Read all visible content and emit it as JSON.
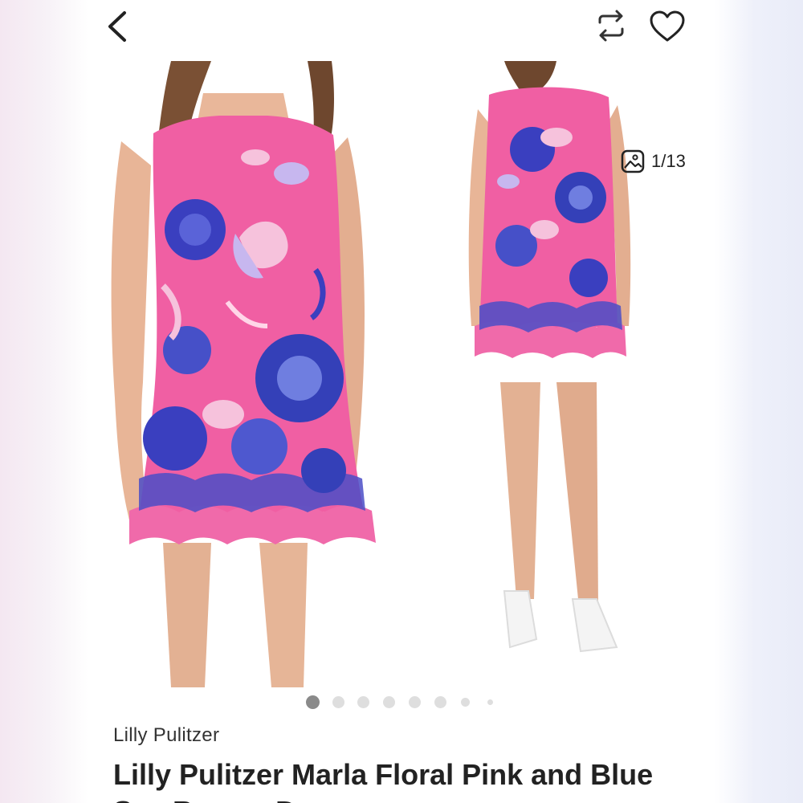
{
  "header": {
    "back_icon": "chevron-left-icon",
    "share_icon": "repost-icon",
    "like_icon": "heart-outline-icon"
  },
  "gallery": {
    "counter": "1/13",
    "counter_icon": "image-icon",
    "current_index": 1,
    "dot_count": 8,
    "colors": {
      "dress_pink": "#f05fa3",
      "print_blue": "#3a3fbf",
      "print_light": "#f6c2dc",
      "skin": "#e9b79a",
      "hair": "#7a5034"
    }
  },
  "listing": {
    "brand": "Lilly Pulitzer",
    "title": "Lilly Pulitzer Marla Floral Pink and Blue",
    "title_cont": "Sea Breeze Dress"
  }
}
